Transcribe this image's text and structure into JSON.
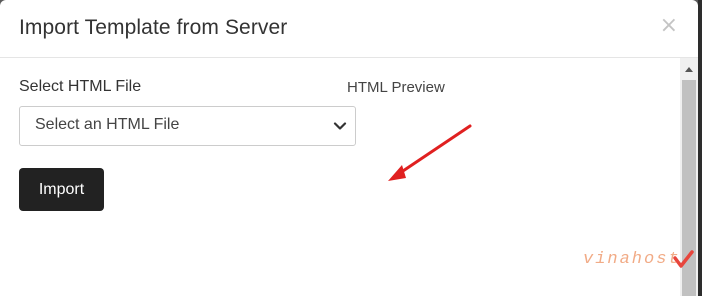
{
  "modal": {
    "title": "Import Template from Server",
    "close_symbol": "×"
  },
  "form": {
    "select_label": "Select HTML File",
    "select_value": "Select an HTML File",
    "preview_label": "HTML Preview",
    "import_label": "Import"
  },
  "watermark": {
    "text": "vinahost"
  },
  "icons": {
    "close": "close-icon",
    "chevron": "chevron-down-icon",
    "scroll_up": "scroll-up-icon",
    "arrow": "red-arrow-annotation"
  },
  "colors": {
    "button_bg": "#222222",
    "arrow": "#e02020",
    "overlay": "#5b5b5b"
  }
}
